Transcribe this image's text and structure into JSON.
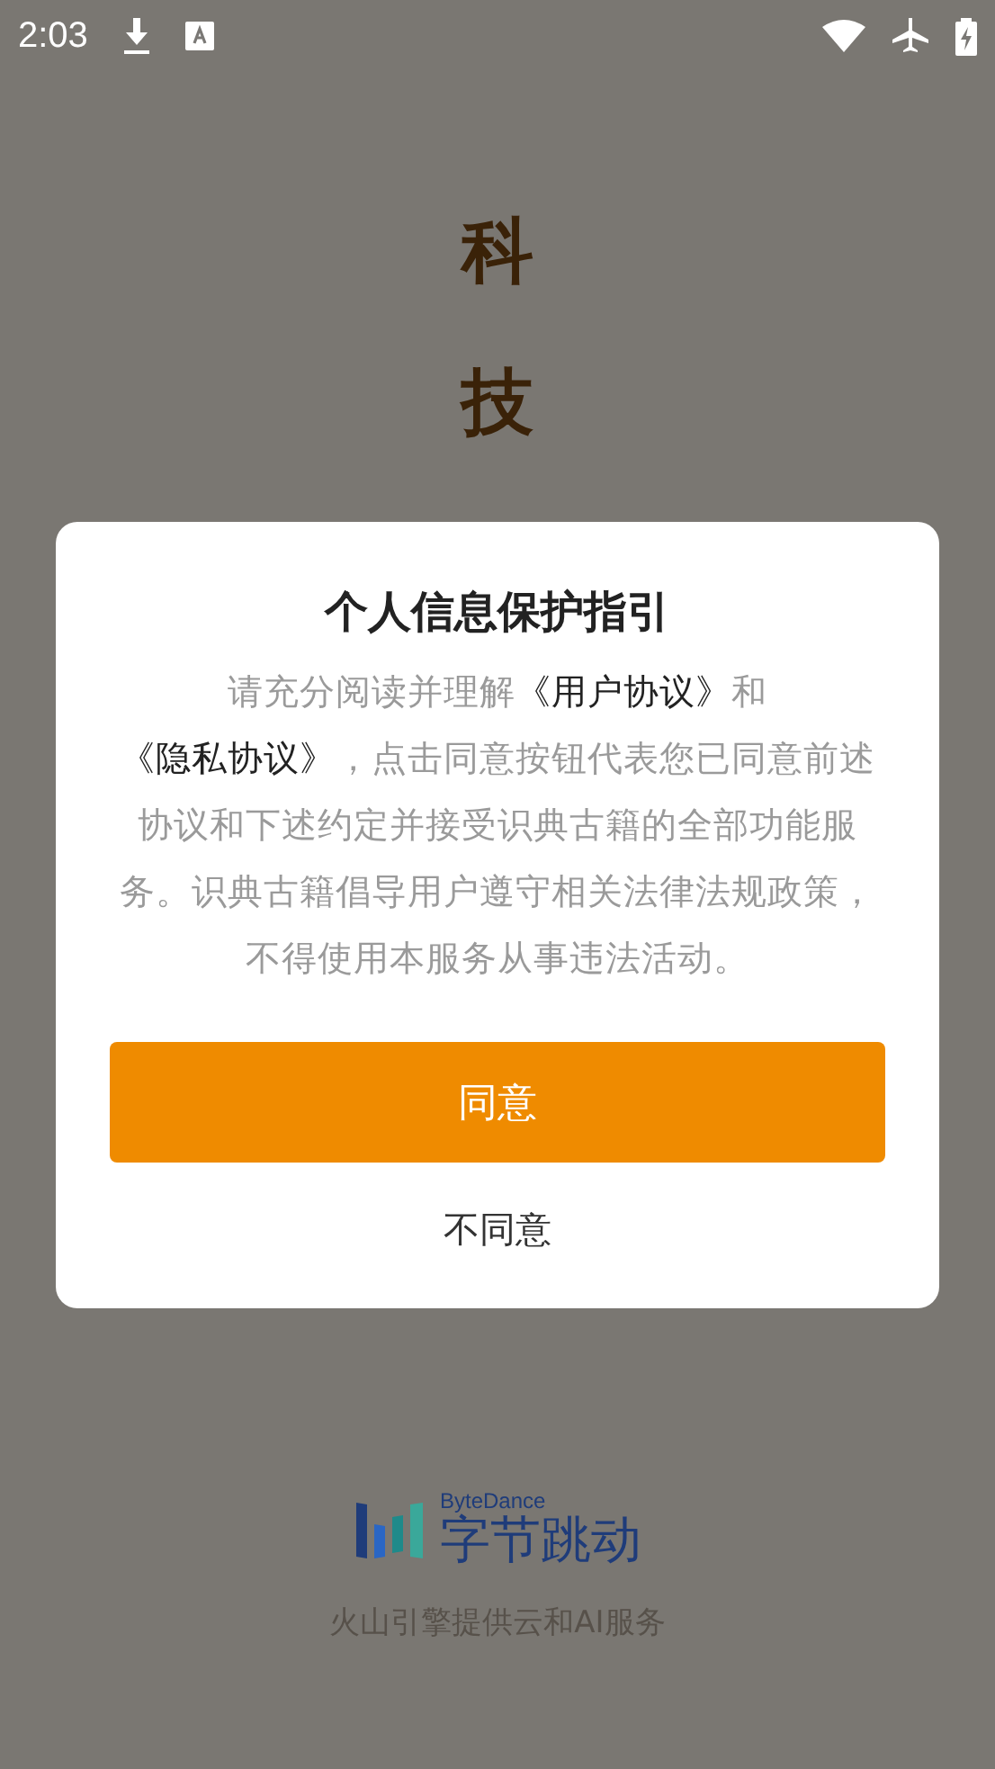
{
  "status_bar": {
    "time": "2:03"
  },
  "splash": {
    "vertical_title": "科技",
    "brand_latin": "ByteDance",
    "brand_name": "字节跳动",
    "credit": "火山引擎提供云和AI服务"
  },
  "dialog": {
    "title": "个人信息保护指引",
    "body": [
      {
        "kind": "plain",
        "text": "请充分阅读并理解"
      },
      {
        "kind": "link",
        "text": "《用户协议》"
      },
      {
        "kind": "plain",
        "text": "和"
      },
      {
        "kind": "link",
        "text": "《隐私协议》"
      },
      {
        "kind": "plain",
        "text": "，点击同意按钮代表您已同意前述协议和下述约定并接受识典古籍的全部功能服务。识典古籍倡导用户遵守相关法律法规政策，不得使用本服务从事违法活动。"
      }
    ],
    "buttons": [
      {
        "kind": "primary",
        "label": "同意"
      },
      {
        "kind": "text",
        "label": "不同意"
      }
    ]
  }
}
